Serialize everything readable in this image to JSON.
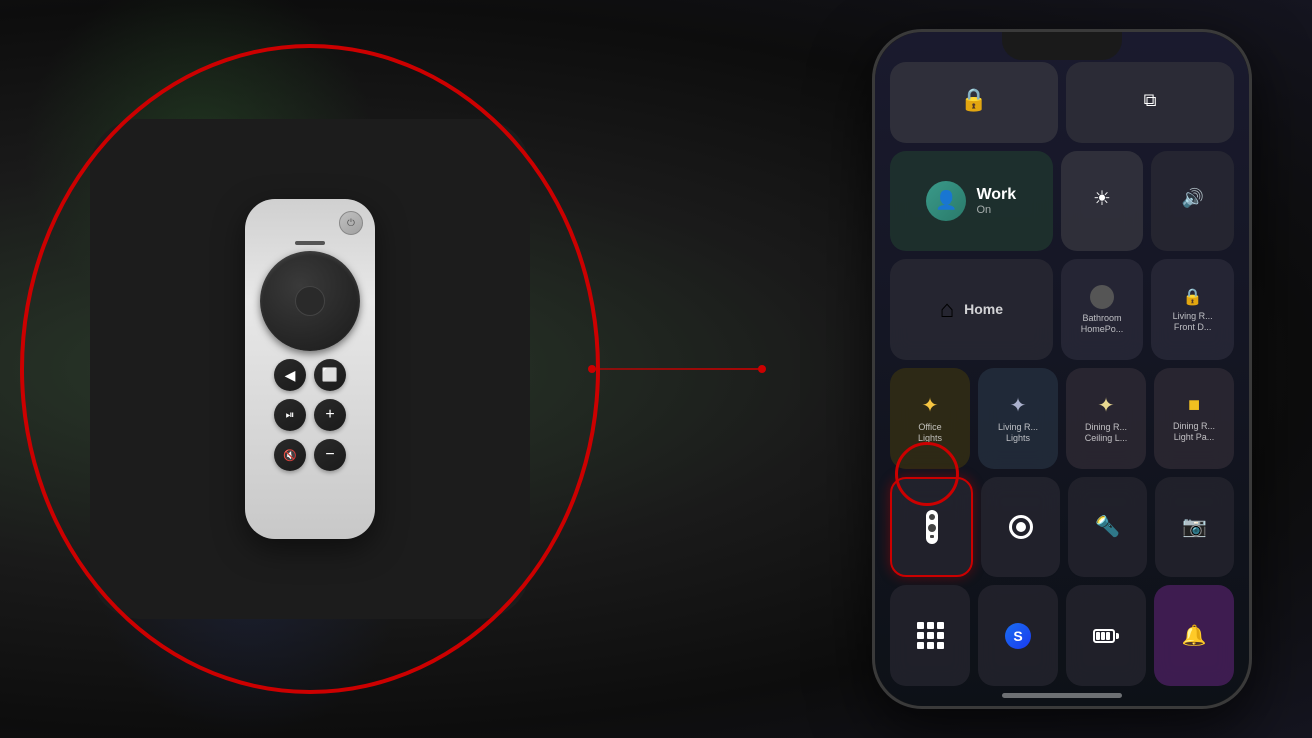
{
  "background": {
    "color": "#1a1a1a"
  },
  "apple_tv": {
    "label": "Apple TV Remote App"
  },
  "remote": {
    "power_icon": "⏻",
    "back_icon": "◀",
    "tv_icon": "📺",
    "play_icon": "⏯",
    "plus_icon": "+",
    "mute_icon": "🔇",
    "minus_icon": "−"
  },
  "phone": {
    "control_center": {
      "row1": [
        {
          "id": "lock-rotation",
          "icon": "🔒",
          "label": ""
        },
        {
          "id": "mirror",
          "icon": "⧉",
          "label": ""
        }
      ],
      "row2": [
        {
          "id": "work",
          "icon": "👤",
          "label": "Work",
          "sublabel": "On",
          "wide": true
        },
        {
          "id": "brightness",
          "icon": "☀",
          "label": ""
        },
        {
          "id": "volume",
          "icon": "🔊",
          "label": ""
        }
      ],
      "row3": [
        {
          "id": "home",
          "icon": "⌂",
          "label": "Home",
          "wide": true
        },
        {
          "id": "bathroom",
          "label": "Bathroom\nHomePo...",
          "icon": "●"
        },
        {
          "id": "living-front",
          "label": "Living R...\nFront D...",
          "icon": "🔒"
        }
      ],
      "row4": [
        {
          "id": "office-lights",
          "icon": "✦",
          "label": "Office\nLights",
          "yellow": true
        },
        {
          "id": "living-lights",
          "icon": "✦",
          "label": "Living R...\nLights"
        },
        {
          "id": "dining-ceiling",
          "icon": "✦",
          "label": "Dining R...\nCeiling L..."
        },
        {
          "id": "dining-light-pa",
          "icon": "✦",
          "label": "Dining R...\nLight Pa..."
        }
      ],
      "row5": [
        {
          "id": "remote",
          "icon": "📱",
          "label": "",
          "highlighted": true
        },
        {
          "id": "record",
          "icon": "⊙",
          "label": ""
        },
        {
          "id": "flashlight",
          "icon": "🔦",
          "label": ""
        },
        {
          "id": "camera",
          "icon": "📷",
          "label": ""
        }
      ],
      "row6": [
        {
          "id": "calculator",
          "icon": "⊞",
          "label": ""
        },
        {
          "id": "shazam",
          "icon": "◉",
          "label": ""
        },
        {
          "id": "battery",
          "icon": "🔋",
          "label": ""
        },
        {
          "id": "notifications",
          "icon": "🔔",
          "label": ""
        }
      ]
    }
  },
  "labels": {
    "work": "Work",
    "work_on": "On",
    "home": "Home",
    "office_lights": "Office\nLights",
    "living_lights": "Living R...\nLights",
    "dining_ceiling": "Dining R...\nCeiling L...",
    "dining_light": "Dining R...\nLight Pa...",
    "bathroom": "Bathroom\nHomePo...",
    "living_front": "Living R...\nFront D..."
  }
}
